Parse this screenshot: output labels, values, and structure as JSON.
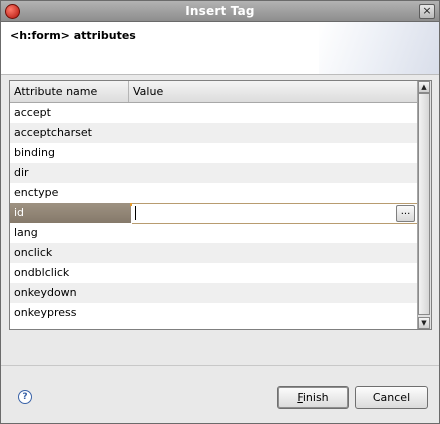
{
  "window": {
    "title": "Insert Tag",
    "close_glyph": "×"
  },
  "header": {
    "title": "<h:form> attributes"
  },
  "table": {
    "columns": [
      "Attribute name",
      "Value"
    ],
    "rows": [
      {
        "name": "accept",
        "value": ""
      },
      {
        "name": "acceptcharset",
        "value": ""
      },
      {
        "name": "binding",
        "value": ""
      },
      {
        "name": "dir",
        "value": ""
      },
      {
        "name": "enctype",
        "value": ""
      },
      {
        "name": "id",
        "value": "",
        "selected": true
      },
      {
        "name": "lang",
        "value": ""
      },
      {
        "name": "onclick",
        "value": ""
      },
      {
        "name": "ondblclick",
        "value": ""
      },
      {
        "name": "onkeydown",
        "value": ""
      },
      {
        "name": "onkeypress",
        "value": ""
      }
    ],
    "browse_label": "...",
    "scroll_up_glyph": "▲",
    "scroll_down_glyph": "▼"
  },
  "footer": {
    "help_glyph": "?",
    "finish_label_accel": "F",
    "finish_label_rest": "inish",
    "cancel_label": "Cancel"
  },
  "colors": {
    "selection": "#8f8373",
    "alt_row": "#efefef",
    "titlebar": "#9e9e9e"
  },
  "icons": {
    "title": "eclipse-app-icon",
    "help": "help-icon",
    "close": "close-icon"
  }
}
